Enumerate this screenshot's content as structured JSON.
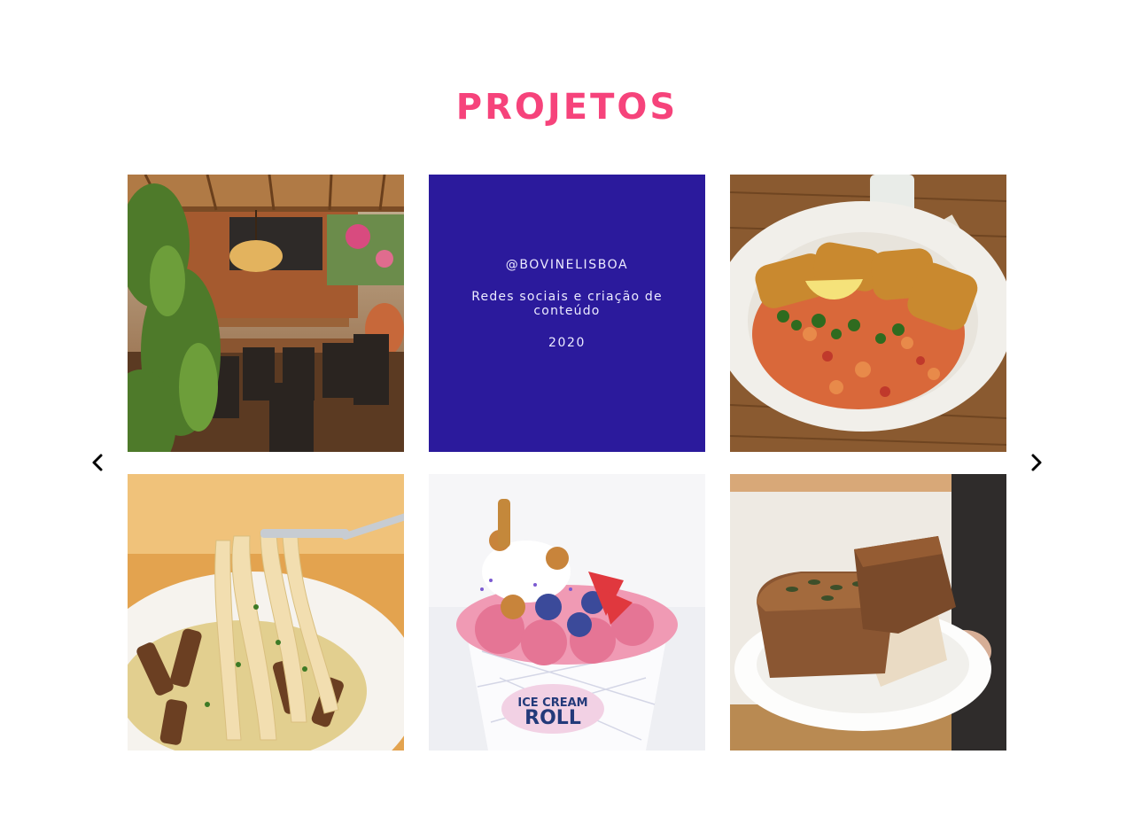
{
  "section": {
    "title": "PROJETOS"
  },
  "gallery": {
    "featured": {
      "handle": "@BOVINELISBOA",
      "description": "Redes sociais e criação de conteúdo",
      "year": "2020"
    },
    "items": [
      {
        "icon": "restaurant-terrace-photo"
      },
      {
        "icon": "info-panel"
      },
      {
        "icon": "fried-fish-rice-photo"
      },
      {
        "icon": "pasta-fork-photo"
      },
      {
        "icon": "ice-cream-roll-photo"
      },
      {
        "icon": "bread-plate-photo"
      }
    ]
  },
  "navigation": {
    "prev_icon": "chevron-left-icon",
    "next_icon": "chevron-right-icon"
  },
  "colors": {
    "title": "#f6437b",
    "panel": "#2b1a9c",
    "panel_text": "#ecebff"
  }
}
